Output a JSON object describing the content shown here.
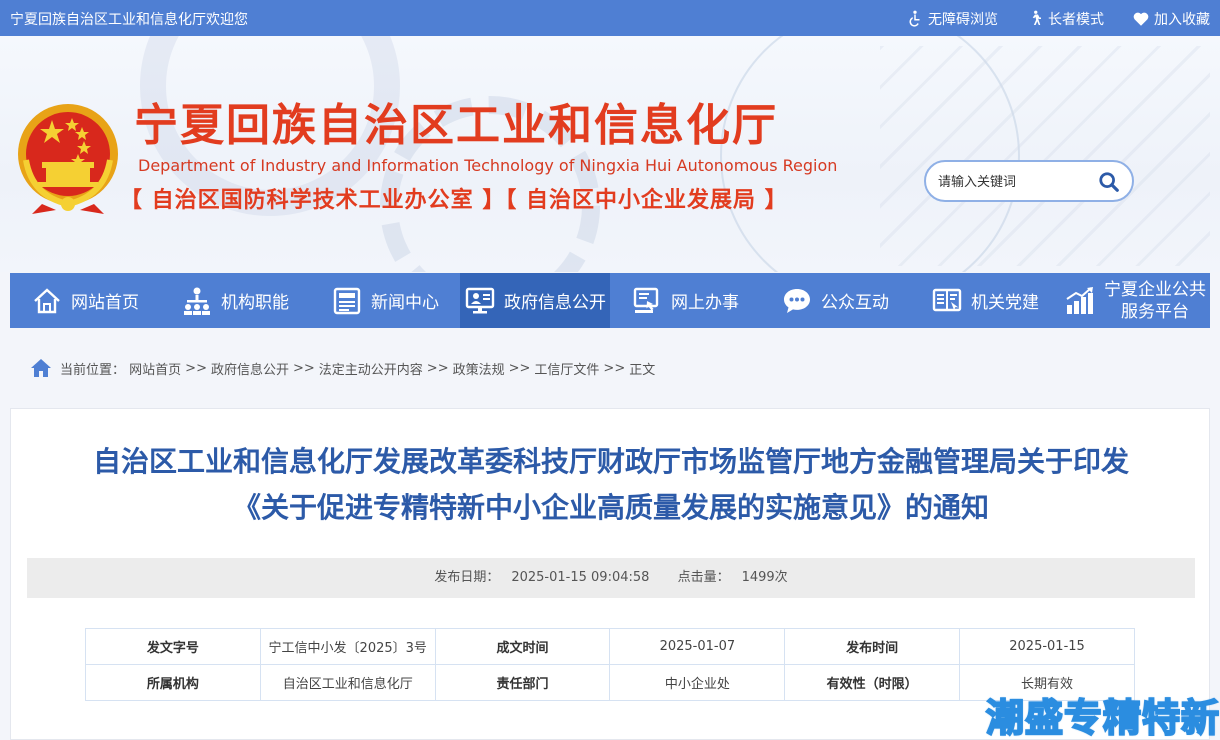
{
  "topbar": {
    "welcome": "宁夏回族自治区工业和信息化厅欢迎您",
    "accessibility": "无障碍浏览",
    "elder_mode": "长者模式",
    "favorite": "加入收藏"
  },
  "header": {
    "title_cn": "宁夏回族自治区工业和信息化厅",
    "title_en": "Department of Industry and Information Technology of Ningxia Hui Autonomous Region",
    "subtitle": "【 自治区国防科学技术工业办公室 】【 自治区中小企业发展局 】"
  },
  "search": {
    "placeholder": "请输入关键词"
  },
  "nav": [
    {
      "label": "网站首页",
      "icon": "home-icon"
    },
    {
      "label": "机构职能",
      "icon": "org-icon"
    },
    {
      "label": "新闻中心",
      "icon": "news-icon"
    },
    {
      "label": "政府信息公开",
      "icon": "monitor-icon",
      "active": true
    },
    {
      "label": "网上办事",
      "icon": "service-icon"
    },
    {
      "label": "公众互动",
      "icon": "chat-icon"
    },
    {
      "label": "机关党建",
      "icon": "book-icon"
    },
    {
      "label_line1": "宁夏企业公共",
      "label_line2": "服务平台",
      "icon": "chart-icon"
    }
  ],
  "breadcrumb": {
    "prefix": "当前位置：",
    "items": [
      "网站首页",
      "政府信息公开",
      "法定主动公开内容",
      "政策法规",
      "工信厅文件",
      "正文"
    ],
    "separator": ">>"
  },
  "article": {
    "title_line1": "自治区工业和信息化厅发展改革委科技厅财政厅市场监管厅地方金融管理局关于印发",
    "title_line2": "《关于促进专精特新中小企业高质量发展的实施意见》的通知",
    "publish_label": "发布日期：",
    "publish_date": "2025-01-15 09:04:58",
    "hits_label": "点击量：",
    "hits": "1499次"
  },
  "info_table": {
    "row1": [
      "发文字号",
      "宁工信中小发〔2025〕3号",
      "成文时间",
      "2025-01-07",
      "发布时间",
      "2025-01-15"
    ],
    "row2": [
      "所属机构",
      "自治区工业和信息化厅",
      "责任部门",
      "中小企业处",
      "有效性（时限）",
      "长期有效"
    ]
  },
  "watermark": "潮盛专精特新",
  "colors": {
    "primary": "#4f7fd3",
    "active": "#3465b8",
    "title_red": "#e23c1f",
    "article_blue": "#2c5aa8"
  }
}
